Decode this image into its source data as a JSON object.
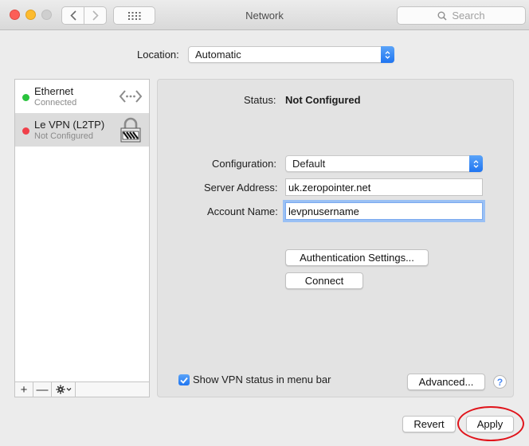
{
  "window": {
    "title": "Network"
  },
  "toolbar": {
    "search_placeholder": "Search"
  },
  "location": {
    "label": "Location:",
    "value": "Automatic"
  },
  "services": [
    {
      "name": "Ethernet",
      "status": "Connected",
      "status_color": "#29c33d",
      "icon": "ethernet-arrows-icon"
    },
    {
      "name": "Le VPN (L2TP)",
      "status": "Not Configured",
      "status_color": "#f0404a",
      "icon": "vpn-lock-icon",
      "selected": true
    }
  ],
  "sidebar_footer": {
    "add": "+",
    "remove": "—"
  },
  "detail": {
    "status_label": "Status:",
    "status_value": "Not Configured",
    "configuration_label": "Configuration:",
    "configuration_value": "Default",
    "server_address_label": "Server Address:",
    "server_address_value": "uk.zeropointer.net",
    "account_name_label": "Account Name:",
    "account_name_value": "levpnusername",
    "authentication_button": "Authentication Settings...",
    "connect_button": "Connect",
    "show_vpn_status_label": "Show VPN status in menu bar",
    "show_vpn_status_checked": true,
    "advanced_button": "Advanced...",
    "help_button": "?"
  },
  "footer": {
    "revert_button": "Revert",
    "apply_button": "Apply"
  },
  "colors": {
    "accent": "#1f75f1",
    "annotation": "#e0141b"
  }
}
